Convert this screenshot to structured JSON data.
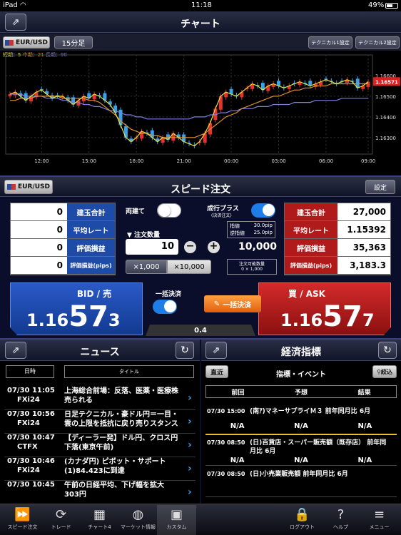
{
  "status": {
    "device": "iPad",
    "time": "11:18",
    "battery": "49%"
  },
  "chart": {
    "title": "チャート",
    "pair": "EUR/USD",
    "timeframe": "15分足",
    "tech1": "テクニカル1設定",
    "tech2": "テクニカル2設定",
    "ma_short": "短期：5",
    "ma_mid": "中期：21",
    "ma_long": "長期：90",
    "yticks": [
      "1.16600",
      "1.16500",
      "1.16400",
      "1.16300"
    ],
    "xticks": [
      "12:00",
      "15:00",
      "18:00",
      "21:00",
      "00:00",
      "03:00",
      "06:00",
      "09:00"
    ],
    "current_price": "1.16571",
    "colors": {
      "up": "#e83030",
      "down": "#3aa0e8",
      "ma_short": "#e8e040",
      "ma_mid": "#e09030",
      "ma_long": "#8080e0"
    }
  },
  "chart_data": {
    "type": "candlestick",
    "ylim": [
      1.1622,
      1.167
    ],
    "ma_short_close": [
      1.1651,
      1.1652,
      1.165,
      1.1648,
      1.165,
      1.1652,
      1.1653,
      1.1651,
      1.1649,
      1.165,
      1.165,
      1.1648,
      1.1646,
      1.1648,
      1.165,
      1.1649,
      1.1651,
      1.165,
      1.1648,
      1.1646,
      1.1642,
      1.1636,
      1.163,
      1.1628,
      1.163,
      1.1633,
      1.1632,
      1.163,
      1.1628,
      1.163,
      1.1629,
      1.1632,
      1.163,
      1.1628,
      1.1627,
      1.1626,
      1.1628,
      1.1632,
      1.1637,
      1.1644,
      1.165,
      1.1652,
      1.1651,
      1.165,
      1.1652,
      1.1654,
      1.1656,
      1.1655,
      1.1653,
      1.1655,
      1.1656,
      1.1655,
      1.1654,
      1.1655,
      1.1656,
      1.1657,
      1.1656,
      1.1655,
      1.1656,
      1.1657,
      1.1658,
      1.1657,
      1.1656,
      1.1657,
      1.1658,
      1.1657,
      1.1654,
      1.1655,
      1.1657
    ],
    "ma_mid_close": [
      1.1648,
      1.1648,
      1.1649,
      1.1649,
      1.1649,
      1.165,
      1.165,
      1.165,
      1.165,
      1.165,
      1.1649,
      1.1649,
      1.1649,
      1.1649,
      1.1649,
      1.1648,
      1.1648,
      1.1647,
      1.1645,
      1.1643,
      1.1641,
      1.1638,
      1.1636,
      1.1634,
      1.1633,
      1.1632,
      1.1632,
      1.1631,
      1.1631,
      1.163,
      1.163,
      1.163,
      1.163,
      1.163,
      1.163,
      1.163,
      1.1631,
      1.1632,
      1.1634,
      1.1636,
      1.1638,
      1.164,
      1.1641,
      1.1642,
      1.1644,
      1.1645,
      1.1646,
      1.1647,
      1.1648,
      1.1649,
      1.165,
      1.165,
      1.1651,
      1.1652,
      1.1653,
      1.1653,
      1.1654,
      1.1654,
      1.1655,
      1.1655,
      1.1655,
      1.1656,
      1.1656,
      1.1656,
      1.1656,
      1.1656,
      1.1656,
      1.1656,
      1.1656
    ],
    "ma_long_close": [
      1.1651,
      1.1651,
      1.1651,
      1.165,
      1.165,
      1.165,
      1.165,
      1.1649,
      1.1649,
      1.1649,
      1.1648,
      1.1648,
      1.1647,
      1.1647,
      1.1646,
      1.1646,
      1.1645,
      1.1645,
      1.1644,
      1.1643,
      1.1643,
      1.1642,
      1.1641,
      1.1641,
      1.164,
      1.164,
      1.1639,
      1.1639,
      1.1639,
      1.1639,
      1.1639,
      1.1639,
      1.1639,
      1.1639,
      1.1639,
      1.164,
      1.164,
      1.164,
      1.1641,
      1.1641,
      1.1642,
      1.1642,
      1.1643,
      1.1643,
      1.1644,
      1.1644,
      1.1644,
      1.1645,
      1.1645,
      1.1645,
      1.1646,
      1.1646,
      1.1646,
      1.1646,
      1.1647,
      1.1647,
      1.1647,
      1.1647,
      1.1648,
      1.1648,
      1.1648,
      1.1648,
      1.1648,
      1.1649,
      1.1649,
      1.1649,
      1.1649,
      1.1649,
      1.1649
    ]
  },
  "speed": {
    "title": "スピード注文",
    "pair": "EUR/USD",
    "settings": "設定",
    "sell_side": {
      "labels": [
        "建玉合計",
        "平均レート",
        "評価損益",
        "評価損益(pips)"
      ],
      "values": [
        "0",
        "0",
        "0",
        "0"
      ]
    },
    "buy_side": {
      "labels": [
        "建玉合計",
        "平均レート",
        "評価損益",
        "評価損益(pips)"
      ],
      "values": [
        "27,000",
        "1.15392",
        "35,363",
        "3,183.3"
      ]
    },
    "ryodate": "両建て",
    "nariyuki": "成行プラス",
    "nariyuki_sub": "(決済注文)",
    "sashine_label": "指値",
    "sashine_val": "30.0pip",
    "gyaku_label": "逆指値",
    "gyaku_val": "25.0pip",
    "qty_label": "▼ 注文数量",
    "qty_value": "10",
    "qty_total": "10,000",
    "mult1": "×1,000",
    "mult2": "×10,000",
    "possible_label": "注文可能数量",
    "possible_val": "0 × 1,000",
    "bid_label": "BID / 売",
    "bid_big1": "1.16",
    "bid_big2": "57",
    "bid_big3": "3",
    "ask_label": "買 / ASK",
    "ask_big1": "1.16",
    "ask_big2": "57",
    "ask_big3": "7",
    "bulk_label": "一括決済",
    "bulk_btn": "一括決済",
    "spread": "0.4"
  },
  "news": {
    "title": "ニュース",
    "col_date": "日時",
    "col_title": "タイトル",
    "items": [
      {
        "time": "07/30 11:05",
        "src": "FXi24",
        "title": "上海総合前場：反落、医薬・医療株売られる"
      },
      {
        "time": "07/30 10:56",
        "src": "FXi24",
        "title": "日足テクニカル・豪ドル円＝一目・雲の上限を抵抗に戻り売りスタンス"
      },
      {
        "time": "07/30 10:47",
        "src": "CTFX",
        "title": "【ディーラー発】ドル円、クロス円下落(東京午前)"
      },
      {
        "time": "07/30 10:46",
        "src": "FXi24",
        "title": "(カナダ円) ピボット・サポート(1)84.423に到達"
      },
      {
        "time": "07/30 10:45",
        "src": "",
        "title": "午前の日経平均、下げ幅を拡大　303円"
      }
    ]
  },
  "econ": {
    "title": "経済指標",
    "recent": "直近",
    "subtitle": "指標・イベント",
    "filter": "絞込",
    "col_prev": "前回",
    "col_forecast": "予想",
    "col_result": "結果",
    "items": [
      {
        "time": "07/30 15:00",
        "title": "(南ｱ)マネーサプライＭ３ 前年同月比 6月",
        "prev": "N/A",
        "forecast": "N/A",
        "result": "N/A"
      },
      {
        "time": "07/30 08:50",
        "title": "(日)百貨店・スーパー販売額（既存店） 前年同月比 6月",
        "prev": "N/A",
        "forecast": "N/A",
        "result": "N/A"
      },
      {
        "time": "07/30 08:50",
        "title": "(日)小売業販売額 前年同月比 6月",
        "prev": "",
        "forecast": "",
        "result": ""
      }
    ]
  },
  "tabs": [
    {
      "label": "スピード注文",
      "icon": "speed-icon"
    },
    {
      "label": "トレード",
      "icon": "refresh-icon"
    },
    {
      "label": "チャート4",
      "icon": "chart4-icon"
    },
    {
      "label": "マーケット情報",
      "icon": "globe-icon"
    },
    {
      "label": "カスタム",
      "icon": "custom-icon"
    },
    {
      "label": "ログアウト",
      "icon": "lock-icon"
    },
    {
      "label": "ヘルプ",
      "icon": "help-icon"
    },
    {
      "label": "メニュー",
      "icon": "menu-icon"
    }
  ]
}
